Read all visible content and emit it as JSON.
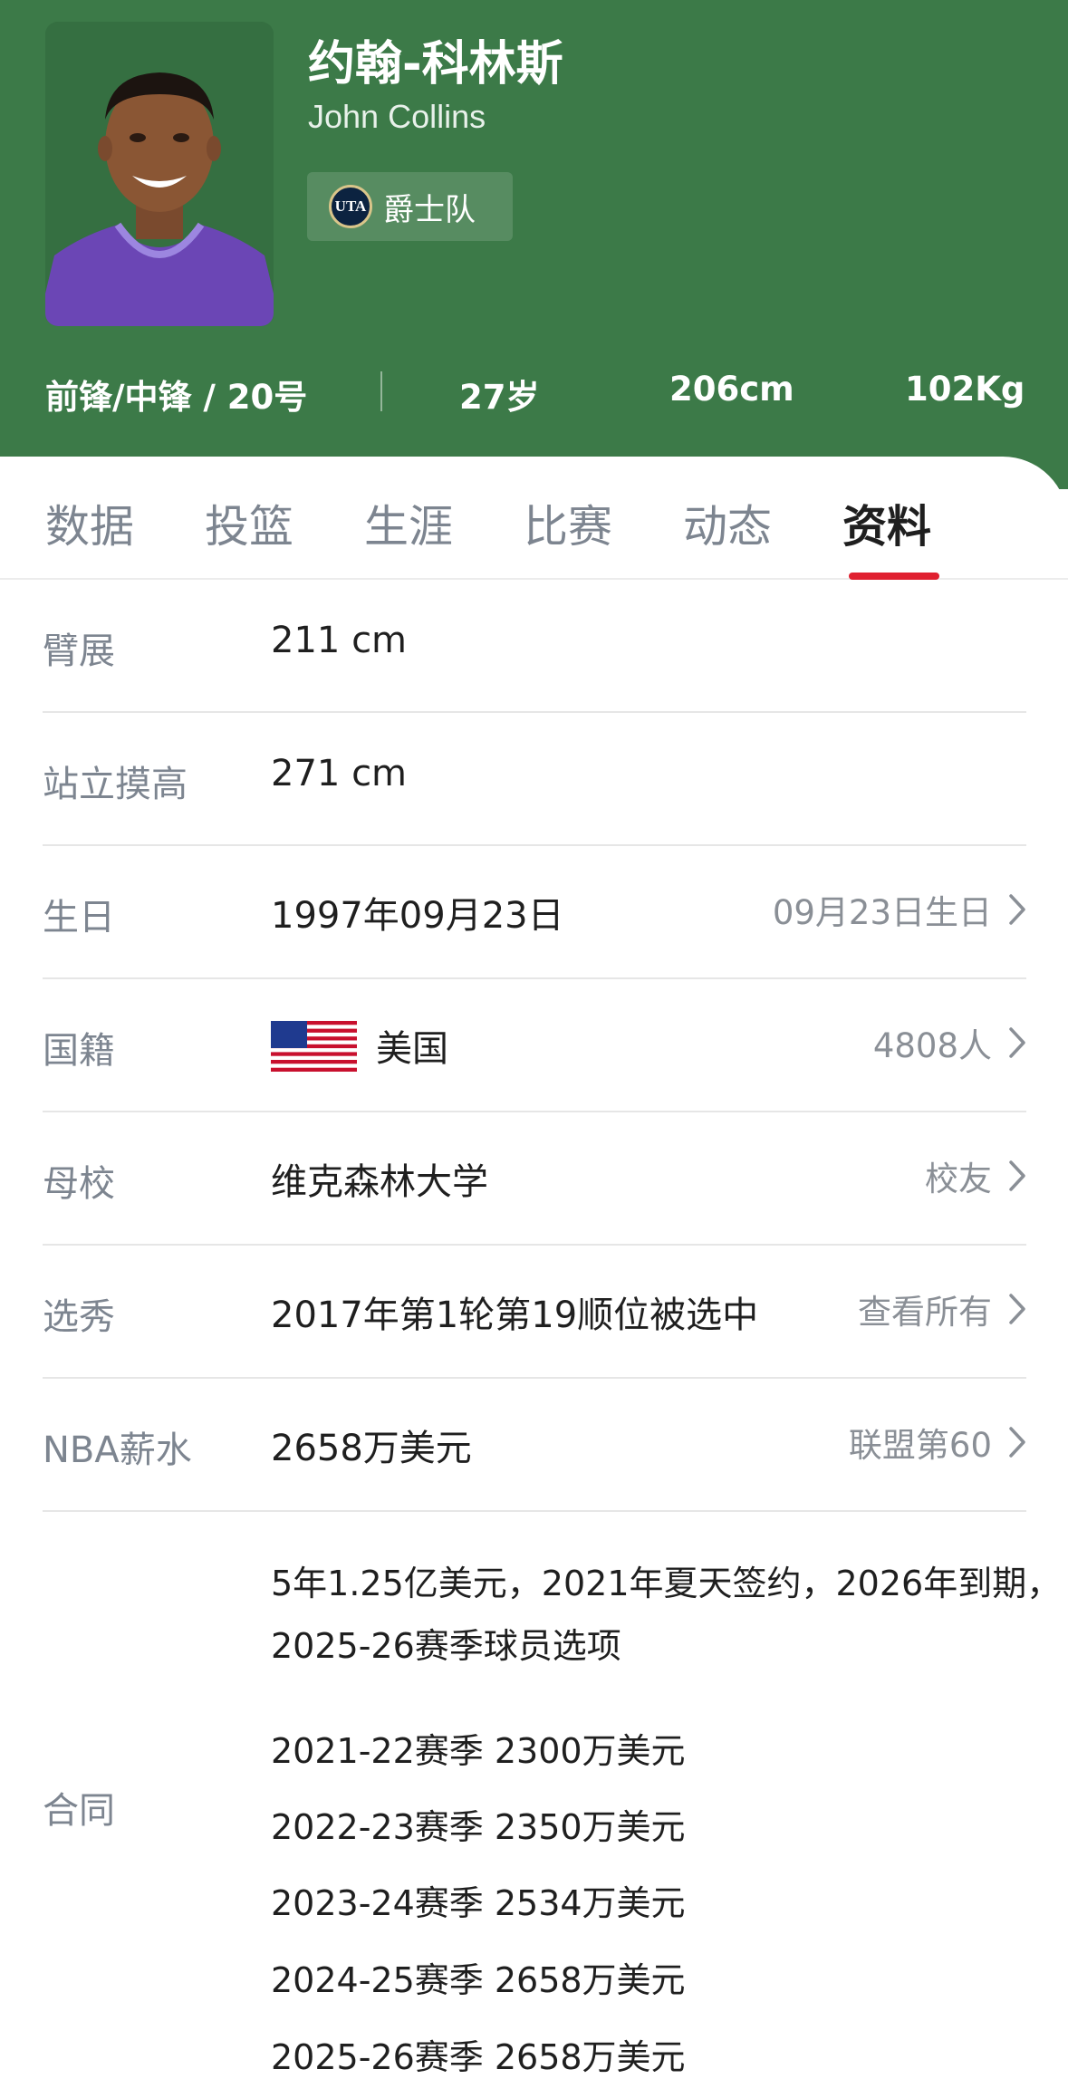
{
  "player": {
    "name_cn": "约翰-科林斯",
    "name_en": "John Collins",
    "team": "爵士队",
    "team_logo_text": "UTA",
    "position_number": "前锋/中锋 / 20号",
    "age": "27岁",
    "height": "206cm",
    "weight": "102Kg"
  },
  "tabs": [
    {
      "label": "数据",
      "active": false
    },
    {
      "label": "投篮",
      "active": false
    },
    {
      "label": "生涯",
      "active": false
    },
    {
      "label": "比赛",
      "active": false
    },
    {
      "label": "动态",
      "active": false
    },
    {
      "label": "资料",
      "active": true
    }
  ],
  "profile": [
    {
      "label": "臂展",
      "value": "211 cm",
      "link": ""
    },
    {
      "label": "站立摸高",
      "value": "271 cm",
      "link": ""
    },
    {
      "label": "生日",
      "value": "1997年09月23日",
      "link": "09月23日生日"
    },
    {
      "label": "国籍",
      "value": "美国",
      "link": "4808人",
      "flag": "us-flag"
    },
    {
      "label": "母校",
      "value": "维克森林大学",
      "link": "校友"
    },
    {
      "label": "选秀",
      "value": "2017年第1轮第19顺位被选中",
      "link": "查看所有"
    },
    {
      "label": "NBA薪水",
      "value": "2658万美元",
      "link": "联盟第60"
    }
  ],
  "contract": {
    "label": "合同",
    "summary": "5年1.25亿美元，2021年夏天签约，2026年到期，2025-26赛季球员选项",
    "seasons": [
      "2021-22赛季 2300万美元",
      "2022-23赛季 2350万美元",
      "2023-24赛季 2534万美元",
      "2024-25赛季 2658万美元",
      "2025-26赛季 2658万美元"
    ]
  },
  "colors": {
    "header_bg": "#3c7a48",
    "tab_indicator": "#e02030",
    "label_gray": "#7d8590"
  }
}
